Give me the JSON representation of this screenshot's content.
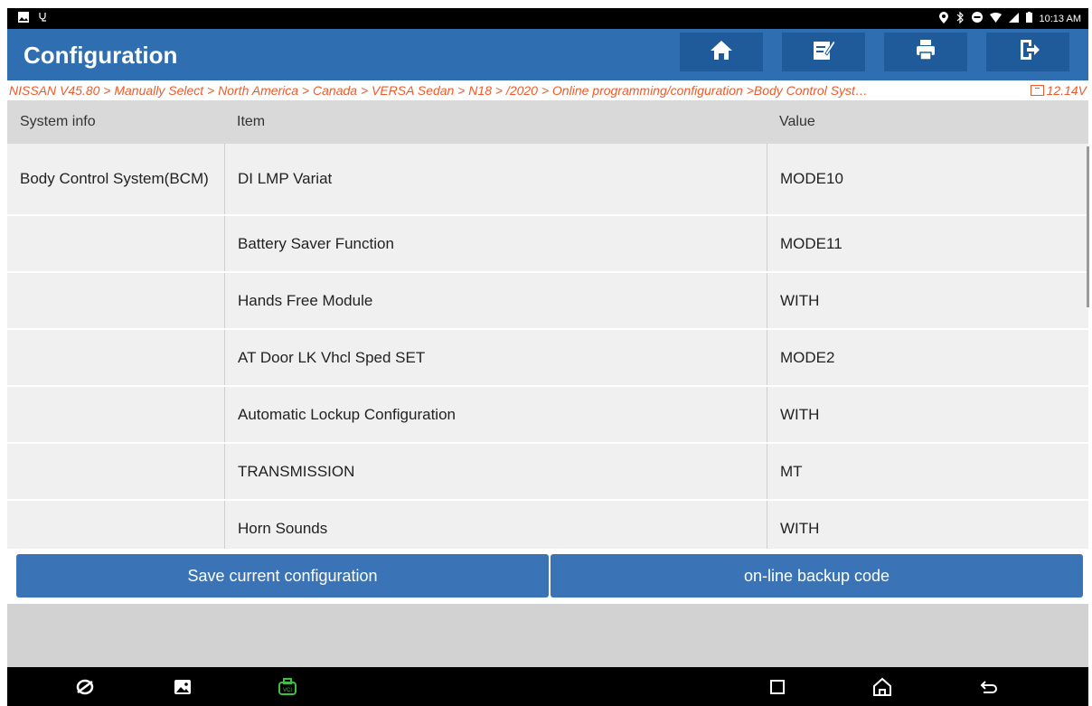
{
  "status_bar": {
    "time": "10:13 AM",
    "left_icons": [
      "gallery-icon",
      "stethoscope-icon"
    ],
    "right_icons": [
      "location-icon",
      "bluetooth-icon",
      "dnd-icon",
      "wifi-icon",
      "signal-icon",
      "battery-icon"
    ]
  },
  "header": {
    "title": "Configuration",
    "buttons": [
      "home-icon",
      "edit-report-icon",
      "print-icon",
      "exit-icon"
    ]
  },
  "breadcrumb": {
    "path": "NISSAN V45.80 > Manually Select > North America > Canada > VERSA Sedan > N18 > /2020 > Online programming/configuration  >Body Control Syst…",
    "voltage": "12.14V"
  },
  "table": {
    "headers": [
      "System info",
      "Item",
      "Value"
    ],
    "rows": [
      {
        "system": "Body Control System(BCM)",
        "item": "DI LMP Variat",
        "value": "MODE10"
      },
      {
        "system": "",
        "item": "Battery Saver Function",
        "value": "MODE11"
      },
      {
        "system": "",
        "item": "Hands Free Module",
        "value": "WITH"
      },
      {
        "system": "",
        "item": "AT Door LK Vhcl Sped SET",
        "value": "MODE2"
      },
      {
        "system": "",
        "item": "Automatic Lockup Configuration",
        "value": "WITH"
      },
      {
        "system": "",
        "item": "TRANSMISSION",
        "value": "MT"
      },
      {
        "system": "",
        "item": "Horn Sounds",
        "value": "WITH"
      }
    ]
  },
  "actions": {
    "save": "Save current configuration",
    "backup": "on-line backup code"
  },
  "nav_bar": {
    "icons": [
      "browser-icon",
      "gallery-icon",
      "vci-icon",
      "recents-icon",
      "home-icon",
      "back-icon"
    ]
  },
  "colors": {
    "header": "#2f6eb0",
    "breadcrumb_text": "#ee5a2a",
    "button": "#3a74b6",
    "vci_green": "#3fbf3f"
  }
}
